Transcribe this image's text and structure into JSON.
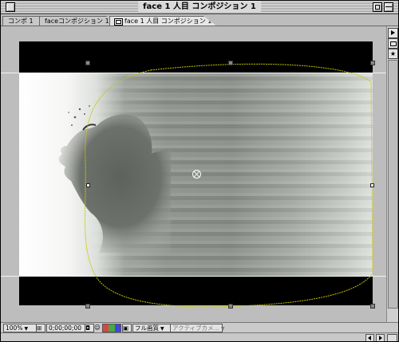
{
  "window": {
    "title": "face 1 人目 コンポジション 1"
  },
  "tabs": [
    {
      "label": "コンポ 1"
    },
    {
      "label": "faceコンポジション 1"
    },
    {
      "label": "face 1 人目 コンポジション 1"
    }
  ],
  "statusbar": {
    "zoom": "100%",
    "timecode": "0;00;00;00",
    "quality": "フル画質",
    "camera": "アクティブカメ..."
  },
  "colors": {
    "mask_path": "#c8c800",
    "canvas_bg": "#000000",
    "pasteboard": "#bdbdbd"
  }
}
